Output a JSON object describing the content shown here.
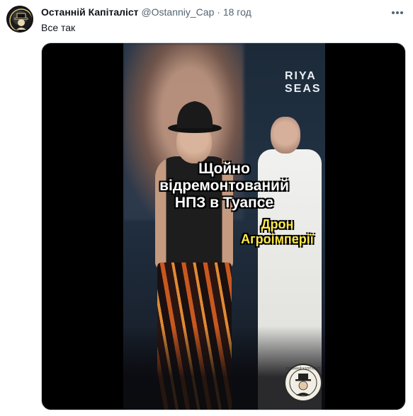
{
  "tweet": {
    "author_name": "Останній Капіталіст",
    "author_handle": "@Ostanniy_Cap",
    "separator": "·",
    "time": "18 год",
    "text": "Все так",
    "more_icon": "more-horizontal-icon"
  },
  "media": {
    "caption_main": "Щойно\nвідремонтований\nНПЗ в Туапсе",
    "caption_side": "Дрон\nАгроімперії",
    "poster_text": "RIYA\nSEAS",
    "watermark_text": "ОСТАННІЙ КАПІТАЛІСТ"
  },
  "colors": {
    "text_primary": "#0f1419",
    "text_secondary": "#536471",
    "caption_side": "#ffe94a",
    "media_background": "#000000"
  }
}
